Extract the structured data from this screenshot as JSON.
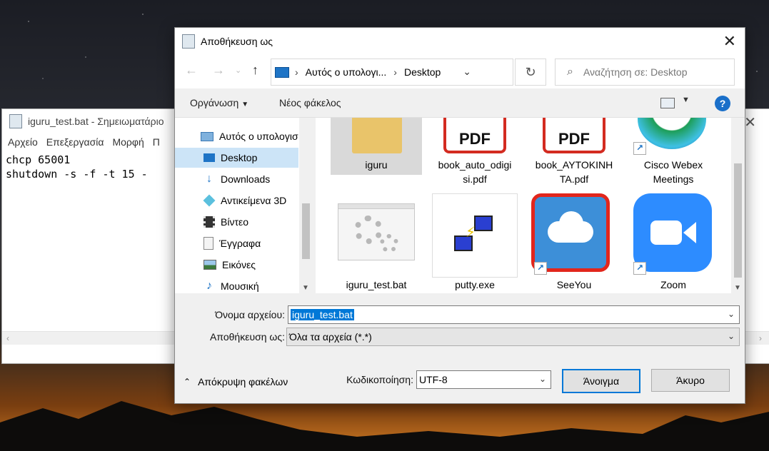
{
  "notepad": {
    "title": "iguru_test.bat - Σημειωματάριο",
    "menu": [
      "Αρχείο",
      "Επεξεργασία",
      "Μορφή",
      "Π"
    ],
    "lines": [
      "chcp 65001",
      "shutdown -s -f -t 15 -"
    ]
  },
  "dialog": {
    "title": "Αποθήκευση ως",
    "address": {
      "root": "Αυτός ο υπολογι...",
      "current": "Desktop"
    },
    "search_placeholder": "Αναζήτηση σε: Desktop",
    "toolbar": {
      "organize": "Οργάνωση",
      "new_folder": "Νέος φάκελος",
      "help": "?"
    },
    "nav_items": [
      {
        "label": "Αυτός ο υπολογισ",
        "icon": "computer-icon"
      },
      {
        "label": "Desktop",
        "icon": "desktop-icon",
        "selected": true
      },
      {
        "label": "Downloads",
        "icon": "download-icon"
      },
      {
        "label": "Αντικείμενα 3D",
        "icon": "cube-3d-icon"
      },
      {
        "label": "Βίντεο",
        "icon": "video-icon"
      },
      {
        "label": "Έγγραφα",
        "icon": "document-icon"
      },
      {
        "label": "Εικόνες",
        "icon": "pictures-icon"
      },
      {
        "label": "Μουσική",
        "icon": "music-icon"
      }
    ],
    "files": [
      {
        "name": "iguru",
        "icon": "folder-icon",
        "selected": true
      },
      {
        "name": "book_auto_odigi si.pdf",
        "line1": "book_auto_odigi",
        "line2": "si.pdf",
        "icon": "pdf-icon"
      },
      {
        "name": "book_AYTOKINH TA.pdf",
        "line1": "book_AYTOKINH",
        "line2": "TA.pdf",
        "icon": "pdf-icon"
      },
      {
        "name": "Cisco Webex Meetings",
        "line1": "Cisco Webex",
        "line2": "Meetings",
        "icon": "webex-icon"
      },
      {
        "name": "iguru_test.bat",
        "icon": "batch-file-icon"
      },
      {
        "name": "putty.exe",
        "icon": "putty-icon"
      },
      {
        "name": "SeeYou",
        "icon": "seeyou-cloud-icon"
      },
      {
        "name": "Zoom",
        "icon": "zoom-camera-icon"
      }
    ],
    "filename_label": "Όνομα αρχείου:",
    "filename_value": "iguru_test.bat",
    "savetype_label": "Αποθήκευση ως:",
    "savetype_value": "Όλα τα αρχεία  (*.*)",
    "hide_folders": "Απόκρυψη φακέλων",
    "encoding_label": "Κωδικοποίηση:",
    "encoding_value": "UTF-8",
    "open_button": "Άνοιγμα",
    "cancel_button": "Άκυρο",
    "colors": {
      "accent": "#0078d7",
      "selection": "#cce4f7",
      "pdf_red": "#d32b21",
      "zoom_blue": "#2d8cff"
    }
  }
}
